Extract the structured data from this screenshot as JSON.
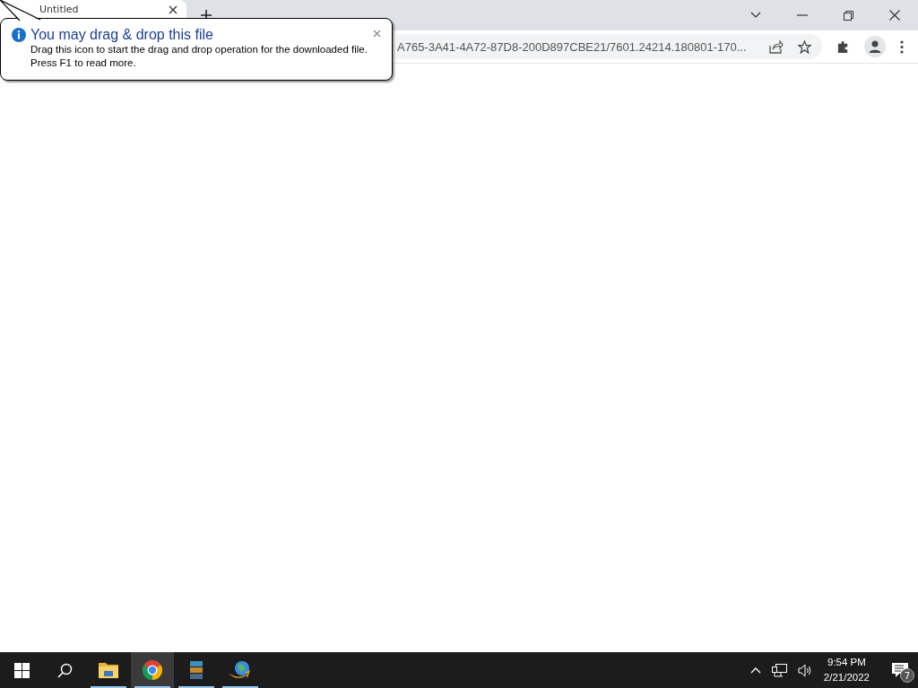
{
  "tabs": [
    {
      "title": "Untitled",
      "selected": true
    }
  ],
  "address_bar": {
    "url": "A765-3A41-4A72-87D8-200D897CBE21/7601.24214.180801-170..."
  },
  "balloon": {
    "title": "You may drag & drop this file",
    "message": "Drag this icon to start the drag and drop operation for the downloaded file.",
    "hint": "Press F1 to read more."
  },
  "taskbar": {
    "apps": [
      {
        "kind": "folder",
        "running": true,
        "selected": false
      },
      {
        "kind": "browser",
        "running": true,
        "selected": true
      },
      {
        "kind": "archive",
        "running": true,
        "selected": false
      },
      {
        "kind": "globe",
        "running": true,
        "selected": false
      }
    ],
    "clock": {
      "time": "9:54 PM",
      "date": "2/21/2022"
    },
    "notifications": "7"
  }
}
